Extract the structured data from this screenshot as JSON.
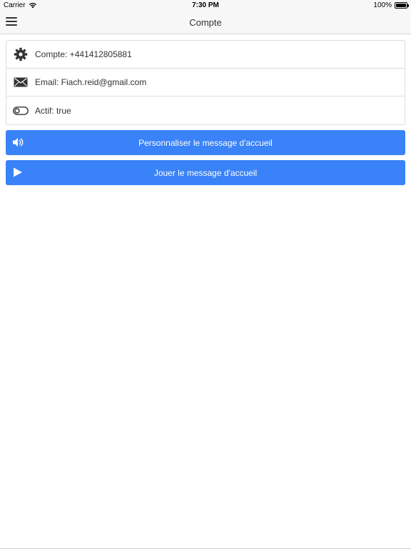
{
  "status_bar": {
    "carrier": "Carrier",
    "time": "7:30 PM",
    "battery": "100%"
  },
  "nav": {
    "title": "Compte"
  },
  "account": {
    "items": [
      {
        "label": "Compte: +441412805881",
        "icon": "gear-icon"
      },
      {
        "label": "Email: Fiach.reid@gmail.com",
        "icon": "envelope-icon"
      },
      {
        "label": "Actif: true",
        "icon": "toggle-icon"
      }
    ]
  },
  "buttons": {
    "customize_label": "Personnaliser le message d'accueil",
    "play_label": "Jouer le message d'accueil"
  },
  "colors": {
    "primary": "#3a82f7"
  }
}
